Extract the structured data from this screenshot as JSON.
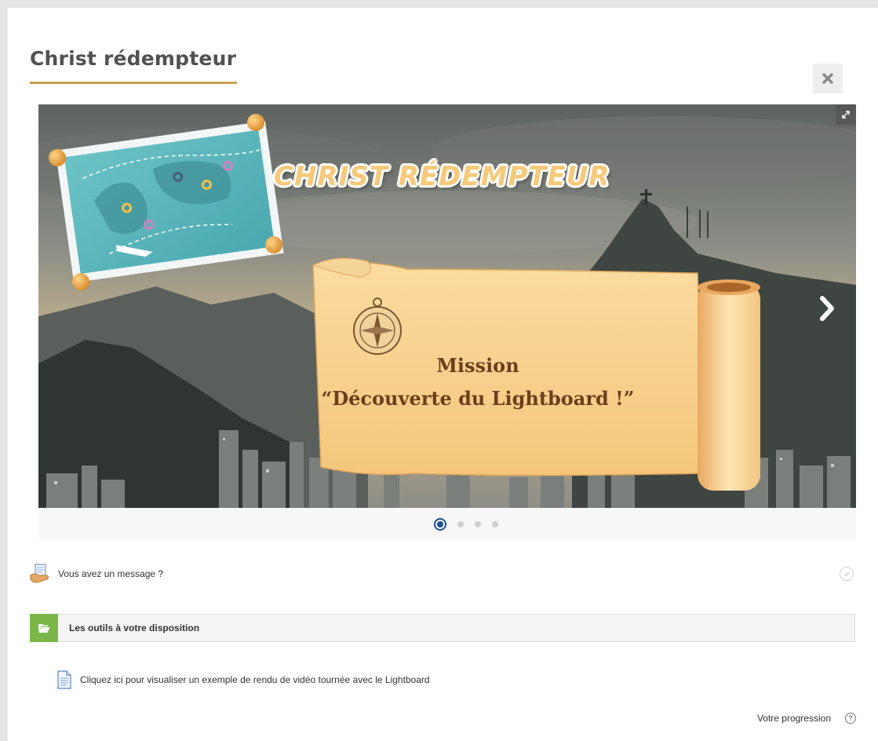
{
  "page": {
    "title": "Christ rédempteur"
  },
  "slider": {
    "slide_heading": "CHRIST RÉDEMPTEUR",
    "mission_line1": "Mission",
    "mission_line2": "“Découverte du Lightboard !”",
    "slide_count": 4,
    "active_slide": 1
  },
  "message_link": {
    "label": "Vous avez un message ?"
  },
  "section": {
    "label": "Les outils à votre disposition"
  },
  "resource": {
    "label": "Cliquez ici pour visualiser un exemple de rendu de vidéo tournée avec le Lightboard"
  },
  "footer": {
    "progress_label": "Votre progression",
    "help_icon_glyph": "?"
  },
  "colors": {
    "accent": "#c9a04e",
    "section_green": "#7ab648",
    "dot_active": "#1d4f91"
  }
}
